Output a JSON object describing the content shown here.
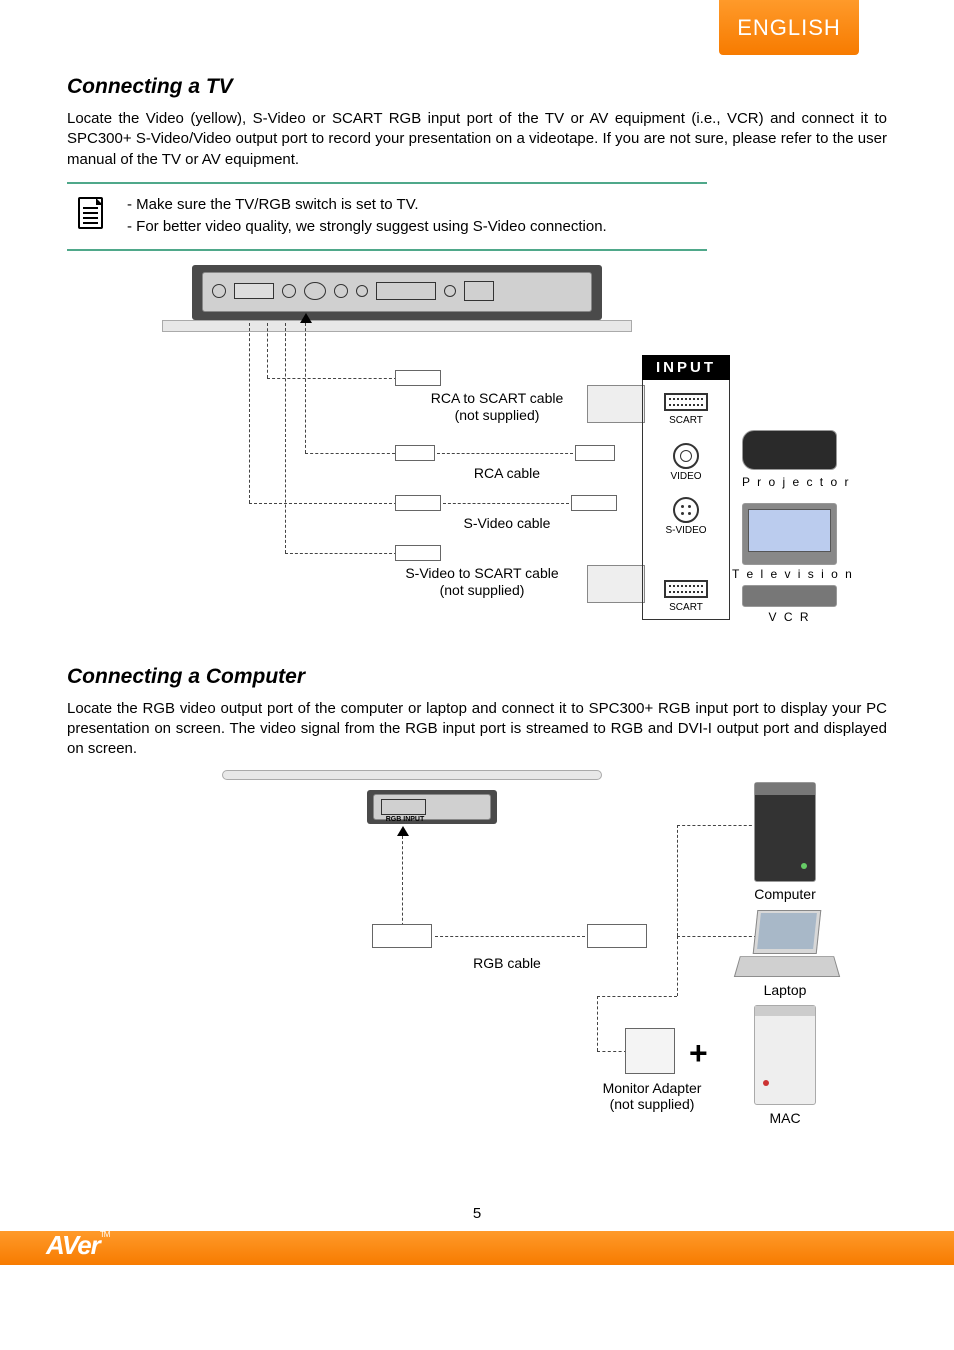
{
  "language_tab": "ENGLISH",
  "page_number": "5",
  "brand": "AVer",
  "section1": {
    "heading": "Connecting a TV",
    "paragraph": "Locate the Video (yellow), S-Video or SCART RGB input port of the TV or AV equipment (i.e., VCR) and connect it to SPC300+ S-Video/Video output port to record your presentation on a videotape. If you are not sure, please refer to the user manual of the TV or AV equipment.",
    "notes": [
      "Make sure the TV/RGB switch is set to TV.",
      "For better video quality, we strongly suggest using S-Video connection."
    ],
    "diagram": {
      "input_header": "INPUT",
      "cable1_line1": "RCA to SCART cable",
      "cable1_line2": "(not supplied)",
      "cable2": "RCA cable",
      "cable3": "S-Video cable",
      "cable4_line1": "S-Video to SCART cable",
      "cable4_line2": "(not supplied)",
      "port_scart1": "SCART",
      "port_video": "VIDEO",
      "port_svideo": "S-VIDEO",
      "port_scart2": "SCART",
      "device_projector": "P r o j e c t o r",
      "device_tv": "T e l e v i s i o n",
      "device_vcr": "V C R"
    }
  },
  "section2": {
    "heading": "Connecting a Computer",
    "paragraph": "Locate the RGB video output port of the computer or laptop and connect it to SPC300+ RGB input port to display your PC presentation on screen. The video signal from the RGB input port is streamed to RGB and DVI-I output port and displayed on screen.",
    "diagram": {
      "cable_rgb": "RGB cable",
      "adapter_line1": "Monitor Adapter",
      "adapter_line2": "(not supplied)",
      "device_computer": "Computer",
      "device_laptop": "Laptop",
      "device_mac": "MAC",
      "rgb_input_label": "RGB INPUT"
    }
  }
}
